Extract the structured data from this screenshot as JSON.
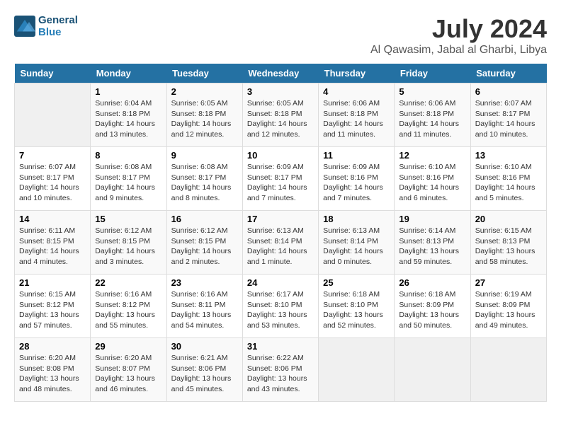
{
  "header": {
    "logo_line1": "General",
    "logo_line2": "Blue",
    "month_year": "July 2024",
    "location": "Al Qawasim, Jabal al Gharbi, Libya"
  },
  "days_of_week": [
    "Sunday",
    "Monday",
    "Tuesday",
    "Wednesday",
    "Thursday",
    "Friday",
    "Saturday"
  ],
  "weeks": [
    [
      {
        "day": "",
        "info": ""
      },
      {
        "day": "1",
        "info": "Sunrise: 6:04 AM\nSunset: 8:18 PM\nDaylight: 14 hours\nand 13 minutes."
      },
      {
        "day": "2",
        "info": "Sunrise: 6:05 AM\nSunset: 8:18 PM\nDaylight: 14 hours\nand 12 minutes."
      },
      {
        "day": "3",
        "info": "Sunrise: 6:05 AM\nSunset: 8:18 PM\nDaylight: 14 hours\nand 12 minutes."
      },
      {
        "day": "4",
        "info": "Sunrise: 6:06 AM\nSunset: 8:18 PM\nDaylight: 14 hours\nand 11 minutes."
      },
      {
        "day": "5",
        "info": "Sunrise: 6:06 AM\nSunset: 8:18 PM\nDaylight: 14 hours\nand 11 minutes."
      },
      {
        "day": "6",
        "info": "Sunrise: 6:07 AM\nSunset: 8:17 PM\nDaylight: 14 hours\nand 10 minutes."
      }
    ],
    [
      {
        "day": "7",
        "info": "Sunrise: 6:07 AM\nSunset: 8:17 PM\nDaylight: 14 hours\nand 10 minutes."
      },
      {
        "day": "8",
        "info": "Sunrise: 6:08 AM\nSunset: 8:17 PM\nDaylight: 14 hours\nand 9 minutes."
      },
      {
        "day": "9",
        "info": "Sunrise: 6:08 AM\nSunset: 8:17 PM\nDaylight: 14 hours\nand 8 minutes."
      },
      {
        "day": "10",
        "info": "Sunrise: 6:09 AM\nSunset: 8:17 PM\nDaylight: 14 hours\nand 7 minutes."
      },
      {
        "day": "11",
        "info": "Sunrise: 6:09 AM\nSunset: 8:16 PM\nDaylight: 14 hours\nand 7 minutes."
      },
      {
        "day": "12",
        "info": "Sunrise: 6:10 AM\nSunset: 8:16 PM\nDaylight: 14 hours\nand 6 minutes."
      },
      {
        "day": "13",
        "info": "Sunrise: 6:10 AM\nSunset: 8:16 PM\nDaylight: 14 hours\nand 5 minutes."
      }
    ],
    [
      {
        "day": "14",
        "info": "Sunrise: 6:11 AM\nSunset: 8:15 PM\nDaylight: 14 hours\nand 4 minutes."
      },
      {
        "day": "15",
        "info": "Sunrise: 6:12 AM\nSunset: 8:15 PM\nDaylight: 14 hours\nand 3 minutes."
      },
      {
        "day": "16",
        "info": "Sunrise: 6:12 AM\nSunset: 8:15 PM\nDaylight: 14 hours\nand 2 minutes."
      },
      {
        "day": "17",
        "info": "Sunrise: 6:13 AM\nSunset: 8:14 PM\nDaylight: 14 hours\nand 1 minute."
      },
      {
        "day": "18",
        "info": "Sunrise: 6:13 AM\nSunset: 8:14 PM\nDaylight: 14 hours\nand 0 minutes."
      },
      {
        "day": "19",
        "info": "Sunrise: 6:14 AM\nSunset: 8:13 PM\nDaylight: 13 hours\nand 59 minutes."
      },
      {
        "day": "20",
        "info": "Sunrise: 6:15 AM\nSunset: 8:13 PM\nDaylight: 13 hours\nand 58 minutes."
      }
    ],
    [
      {
        "day": "21",
        "info": "Sunrise: 6:15 AM\nSunset: 8:12 PM\nDaylight: 13 hours\nand 57 minutes."
      },
      {
        "day": "22",
        "info": "Sunrise: 6:16 AM\nSunset: 8:12 PM\nDaylight: 13 hours\nand 55 minutes."
      },
      {
        "day": "23",
        "info": "Sunrise: 6:16 AM\nSunset: 8:11 PM\nDaylight: 13 hours\nand 54 minutes."
      },
      {
        "day": "24",
        "info": "Sunrise: 6:17 AM\nSunset: 8:10 PM\nDaylight: 13 hours\nand 53 minutes."
      },
      {
        "day": "25",
        "info": "Sunrise: 6:18 AM\nSunset: 8:10 PM\nDaylight: 13 hours\nand 52 minutes."
      },
      {
        "day": "26",
        "info": "Sunrise: 6:18 AM\nSunset: 8:09 PM\nDaylight: 13 hours\nand 50 minutes."
      },
      {
        "day": "27",
        "info": "Sunrise: 6:19 AM\nSunset: 8:09 PM\nDaylight: 13 hours\nand 49 minutes."
      }
    ],
    [
      {
        "day": "28",
        "info": "Sunrise: 6:20 AM\nSunset: 8:08 PM\nDaylight: 13 hours\nand 48 minutes."
      },
      {
        "day": "29",
        "info": "Sunrise: 6:20 AM\nSunset: 8:07 PM\nDaylight: 13 hours\nand 46 minutes."
      },
      {
        "day": "30",
        "info": "Sunrise: 6:21 AM\nSunset: 8:06 PM\nDaylight: 13 hours\nand 45 minutes."
      },
      {
        "day": "31",
        "info": "Sunrise: 6:22 AM\nSunset: 8:06 PM\nDaylight: 13 hours\nand 43 minutes."
      },
      {
        "day": "",
        "info": ""
      },
      {
        "day": "",
        "info": ""
      },
      {
        "day": "",
        "info": ""
      }
    ]
  ]
}
